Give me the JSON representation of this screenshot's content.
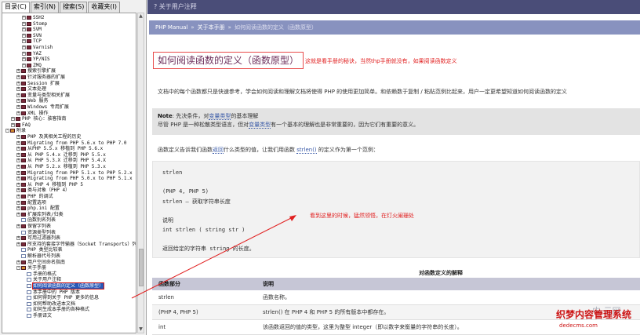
{
  "left_pane": {
    "tabs": [
      "目录(C)",
      "索引(N)",
      "搜索(S)",
      "收藏夹(I)"
    ],
    "tree": [
      {
        "label": "SSH2",
        "indent": 3,
        "icon": "book",
        "toggle": "+"
      },
      {
        "label": "Stomp",
        "indent": 3,
        "icon": "book",
        "toggle": "+"
      },
      {
        "label": "SVM",
        "indent": 3,
        "icon": "book",
        "toggle": "+"
      },
      {
        "label": "SVN",
        "indent": 3,
        "icon": "book",
        "toggle": "+"
      },
      {
        "label": "TCP",
        "indent": 3,
        "icon": "book",
        "toggle": "+"
      },
      {
        "label": "Varnish",
        "indent": 3,
        "icon": "book",
        "toggle": "+"
      },
      {
        "label": "YAZ",
        "indent": 3,
        "icon": "book",
        "toggle": "+"
      },
      {
        "label": "YP/NIS",
        "indent": 3,
        "icon": "book",
        "toggle": "+"
      },
      {
        "label": "ZMQ",
        "indent": 3,
        "icon": "book",
        "toggle": "+"
      },
      {
        "label": "搜索引擎扩展",
        "indent": 2,
        "icon": "book",
        "toggle": "+"
      },
      {
        "label": "针对服务器的扩展",
        "indent": 2,
        "icon": "book",
        "toggle": "+"
      },
      {
        "label": "Session 扩展",
        "indent": 2,
        "icon": "book",
        "toggle": "+"
      },
      {
        "label": "文本处理",
        "indent": 2,
        "icon": "book",
        "toggle": "+"
      },
      {
        "label": "变量与类型相关扩展",
        "indent": 2,
        "icon": "book",
        "toggle": "+"
      },
      {
        "label": "Web 服务",
        "indent": 2,
        "icon": "book",
        "toggle": "+"
      },
      {
        "label": "Windows 专用扩展",
        "indent": 2,
        "icon": "book",
        "toggle": "+"
      },
      {
        "label": "XML 操作",
        "indent": 2,
        "icon": "book",
        "toggle": "+"
      },
      {
        "label": "PHP 核心：骇客指南",
        "indent": 1,
        "icon": "book",
        "toggle": "+"
      },
      {
        "label": "FAQ",
        "indent": 1,
        "icon": "book",
        "toggle": "+"
      },
      {
        "label": "附录",
        "indent": 0,
        "icon": "book",
        "toggle": "-",
        "open": true
      },
      {
        "label": "PHP 及其相关工程的历史",
        "indent": 2,
        "icon": "book",
        "toggle": "+"
      },
      {
        "label": "Migrating from PHP 5.6.x to PHP 7.0",
        "indent": 2,
        "icon": "book",
        "toggle": "+"
      },
      {
        "label": "从PHP 5.5.x 移植到 PHP 5.6.x",
        "indent": 2,
        "icon": "book",
        "toggle": "+"
      },
      {
        "label": "从 PHP 5.4.x 迁移到 PHP 5.5.x",
        "indent": 2,
        "icon": "book",
        "toggle": "+"
      },
      {
        "label": "从 PHP 5.3.X 迁移到 PHP 5.4.X",
        "indent": 2,
        "icon": "book",
        "toggle": "+"
      },
      {
        "label": "从 PHP 5.2.x 移植到 PHP 5.3.x",
        "indent": 2,
        "icon": "book",
        "toggle": "+"
      },
      {
        "label": "Migrating from PHP 5.1.x to PHP 5.2.x",
        "indent": 2,
        "icon": "book",
        "toggle": "+"
      },
      {
        "label": "Migrating from PHP 5.0.x to PHP 5.1.x",
        "indent": 2,
        "icon": "book",
        "toggle": "+"
      },
      {
        "label": "从 PHP 4 移植到 PHP 5",
        "indent": 2,
        "icon": "book",
        "toggle": "+"
      },
      {
        "label": "类与对象（PHP 4）",
        "indent": 2,
        "icon": "book",
        "toggle": "+"
      },
      {
        "label": "PHP 的调试",
        "indent": 2,
        "icon": "book",
        "toggle": "+"
      },
      {
        "label": "配置选项",
        "indent": 2,
        "icon": "book",
        "toggle": "+"
      },
      {
        "label": "php.ini 配置",
        "indent": 2,
        "icon": "book",
        "toggle": "+"
      },
      {
        "label": "扩展库列表/归类",
        "indent": 2,
        "icon": "book",
        "toggle": "+"
      },
      {
        "label": "函数别名列表",
        "indent": 2,
        "icon": "page",
        "toggle": ""
      },
      {
        "label": "保留字列表",
        "indent": 2,
        "icon": "book",
        "toggle": "+"
      },
      {
        "label": "资源类型列表",
        "indent": 2,
        "icon": "page",
        "toggle": ""
      },
      {
        "label": "可用过滤器列表",
        "indent": 2,
        "icon": "book",
        "toggle": "+"
      },
      {
        "label": "所支持的套接字传输器（Socket Transports）列表",
        "indent": 2,
        "icon": "book",
        "toggle": "+"
      },
      {
        "label": "PHP 类型比较表",
        "indent": 2,
        "icon": "page",
        "toggle": ""
      },
      {
        "label": "解析器代号列表",
        "indent": 2,
        "icon": "page",
        "toggle": ""
      },
      {
        "label": "用户空间命名指南",
        "indent": 2,
        "icon": "book",
        "toggle": "+"
      },
      {
        "label": "关于手册",
        "indent": 2,
        "icon": "book",
        "toggle": "-",
        "open": true
      },
      {
        "label": "手册的格式",
        "indent": 3,
        "icon": "page",
        "toggle": ""
      },
      {
        "label": "关于用户注释",
        "indent": 3,
        "icon": "page",
        "toggle": ""
      },
      {
        "label": "如何阅读函数的定义（函数原型）",
        "indent": 3,
        "icon": "page",
        "toggle": "",
        "selected": true
      },
      {
        "label": "本手册中的 PHP 版本",
        "indent": 3,
        "icon": "page",
        "toggle": ""
      },
      {
        "label": "如何得到关于 PHP 更多的信息",
        "indent": 3,
        "icon": "page",
        "toggle": ""
      },
      {
        "label": "如何帮助改进本文档",
        "indent": 3,
        "icon": "page",
        "toggle": ""
      },
      {
        "label": "如何生成本手册的各种格式",
        "indent": 3,
        "icon": "page",
        "toggle": ""
      },
      {
        "label": "手册译文",
        "indent": 3,
        "icon": "page",
        "toggle": ""
      }
    ]
  },
  "topbar": {
    "title": "? 关于用户注释"
  },
  "breadcrumb": {
    "items": [
      "PHP Manual",
      "关于本手册"
    ],
    "current": "如何阅读函数的定义（函数原型）"
  },
  "page": {
    "title": "如何阅读函数的定义（函数原型）",
    "red_note_1": "这就是看手册的秘诀，当然thp手册就没有，如果阅读函数定义",
    "intro": "文档中的每个函数都只是快速参考，学会如何阅读和理解文档将使得 PHP 的使用更加简单。和依赖数于复制 / 粘贴范例比起来，用户一定更希望知道如何阅读函数的定义",
    "note_lead": "Note",
    "note_line1_pre": ": 先决条件，对",
    "note_line1_link": "变量类型",
    "note_line1_post": "的基本理解",
    "note_line2_pre": "尽管 PHP 是一种松散类型语言，但对",
    "note_line2_link": "变量类型",
    "note_line2_post": "有一个基本的理解也是非常重要的，因为它们有重要的意义。",
    "fn_desc_pre": "函数定义告诉我们函数",
    "fn_desc_link1": "返回",
    "fn_desc_mid": "什么类型的值，让我们用函数 ",
    "fn_desc_link2": "strlen()",
    "fn_desc_post": " 的定义作为第一个范例：",
    "code": {
      "line1": "strlen",
      "line2": "(PHP 4, PHP 5)",
      "line3": "strlen — 获取字符串长度",
      "line4": "说明",
      "line5": "int strlen ( string str )",
      "line6": "返回给定的字符串 string 的长度。"
    },
    "red_note_2": "看到这里的时候，猛然领悟，在灯火阑珊处",
    "table": {
      "caption": "对函数定义的解释",
      "headers": [
        "函数部分",
        "说明"
      ],
      "rows": [
        [
          "strlen",
          "函数名称。"
        ],
        [
          "(PHP 4, PHP 5)",
          "strlen() 在 PHP 4 和 PHP 5 的所有版本中都存在。"
        ],
        [
          "int",
          "该函数返回的值的类型，这里为整型 integer（即以数字来衡量的字符串的长度）。"
        ]
      ]
    }
  },
  "watermark": {
    "logo": "中 云网",
    "main": "织梦内容管理系统",
    "sub": "dedecms.com"
  },
  "colors": {
    "annotation": "#e12020",
    "breadcrumb_bg": "#8892bf",
    "topbar_bg": "#4a4d78",
    "selection": "#2859b8"
  }
}
